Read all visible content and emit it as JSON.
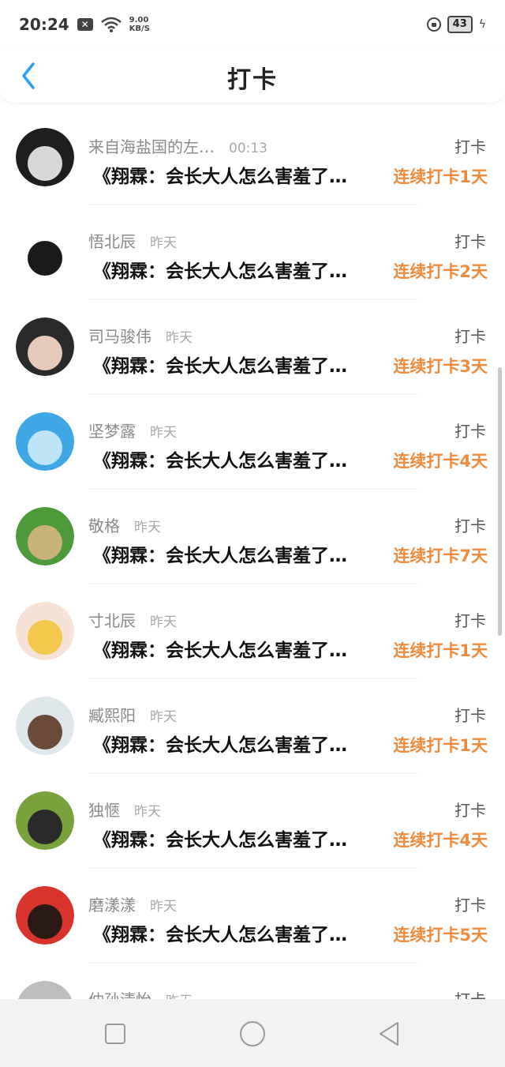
{
  "status_bar": {
    "time": "20:24",
    "notification_icon": "close-box-icon",
    "net_speed_value": "9.00",
    "net_speed_unit": "KB/S",
    "battery": "43"
  },
  "header": {
    "title": "打卡",
    "back_icon": "chevron-left-icon"
  },
  "items": [
    {
      "name": "来自海盐国的左…",
      "time": "00:13",
      "action": "打卡",
      "book": "《翔霖：会长大人怎么害羞了…",
      "streak": "连续打卡1天",
      "avatar_colors": [
        "#1e1e1e",
        "#d8d8d8"
      ]
    },
    {
      "name": "悟北辰",
      "time": "昨天",
      "action": "打卡",
      "book": "《翔霖：会长大人怎么害羞了…",
      "streak": "连续打卡2天",
      "avatar_colors": [
        "#ffffff",
        "#1a1a1a"
      ]
    },
    {
      "name": "司马骏伟",
      "time": "昨天",
      "action": "打卡",
      "book": "《翔霖：会长大人怎么害羞了…",
      "streak": "连续打卡3天",
      "avatar_colors": [
        "#2a2a2a",
        "#e6c9b8"
      ]
    },
    {
      "name": "坚梦露",
      "time": "昨天",
      "action": "打卡",
      "book": "《翔霖：会长大人怎么害羞了…",
      "streak": "连续打卡4天",
      "avatar_colors": [
        "#3fa7e6",
        "#bfe4f7"
      ]
    },
    {
      "name": "敬格",
      "time": "昨天",
      "action": "打卡",
      "book": "《翔霖：会长大人怎么害羞了…",
      "streak": "连续打卡7天",
      "avatar_colors": [
        "#4c9a3a",
        "#c9b27a"
      ]
    },
    {
      "name": "寸北辰",
      "time": "昨天",
      "action": "打卡",
      "book": "《翔霖：会长大人怎么害羞了…",
      "streak": "连续打卡1天",
      "avatar_colors": [
        "#f6e2d6",
        "#f2c94c"
      ]
    },
    {
      "name": "臧熙阳",
      "time": "昨天",
      "action": "打卡",
      "book": "《翔霖：会长大人怎么害羞了…",
      "streak": "连续打卡1天",
      "avatar_colors": [
        "#dfe7ea",
        "#6b4a3a"
      ]
    },
    {
      "name": "独愜",
      "time": "昨天",
      "action": "打卡",
      "book": "《翔霖：会长大人怎么害羞了…",
      "streak": "连续打卡4天",
      "avatar_colors": [
        "#7aa23c",
        "#2a2a2a"
      ]
    },
    {
      "name": "磨漾漾",
      "time": "昨天",
      "action": "打卡",
      "book": "《翔霖：会长大人怎么害羞了…",
      "streak": "连续打卡5天",
      "avatar_colors": [
        "#d9342b",
        "#2a1a16"
      ]
    },
    {
      "name": "仲孙清怡",
      "time": "昨天",
      "action": "打卡",
      "book": "",
      "streak": "",
      "avatar_colors": [
        "#bdbdbd",
        "#555555"
      ]
    }
  ],
  "nav": {
    "recent_icon": "square-recent-icon",
    "home_icon": "circle-home-icon",
    "back_icon": "triangle-back-icon"
  },
  "colors": {
    "accent": "#f08a3c",
    "back_arrow": "#2a9df4"
  }
}
